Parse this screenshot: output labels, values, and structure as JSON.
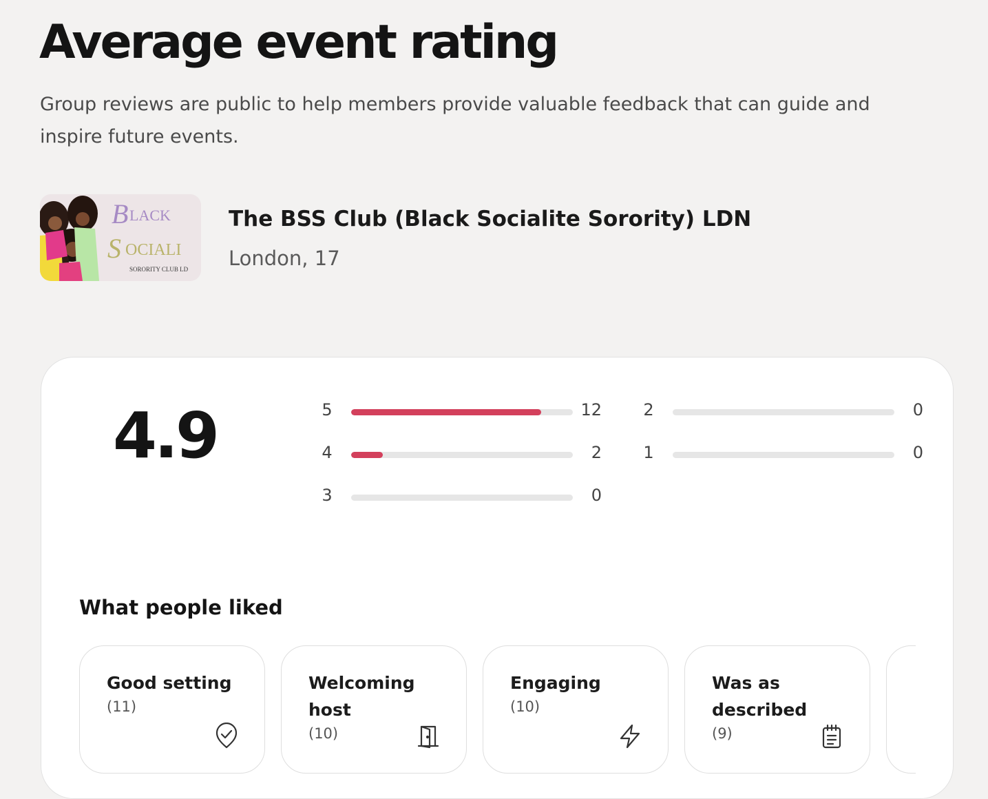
{
  "page": {
    "title": "Average event rating",
    "subtitle": "Group reviews are public to help members provide valuable feedback that can guide and inspire future events."
  },
  "group": {
    "name": "The BSS Club (Black Socialite Sorority) LDN",
    "location": "London, 17",
    "logo_text": [
      "Black",
      "Sociali",
      "SORORITY CLUB LD"
    ]
  },
  "rating": {
    "average": "4.9",
    "accent_color": "#d3405c",
    "breakdown": [
      {
        "stars": "5",
        "count": "12",
        "fraction": 0.857
      },
      {
        "stars": "4",
        "count": "2",
        "fraction": 0.143
      },
      {
        "stars": "3",
        "count": "0",
        "fraction": 0
      },
      {
        "stars": "2",
        "count": "0",
        "fraction": 0
      },
      {
        "stars": "1",
        "count": "0",
        "fraction": 0
      }
    ]
  },
  "liked": {
    "title": "What people liked",
    "items": [
      {
        "label": "Good setting",
        "count": "(11)",
        "icon": "shield-check-icon"
      },
      {
        "label": "Welcoming host",
        "count": "(10)",
        "icon": "door-icon"
      },
      {
        "label": "Engaging",
        "count": "(10)",
        "icon": "lightning-icon"
      },
      {
        "label": "Was as described",
        "count": "(9)",
        "icon": "clipboard-icon"
      }
    ]
  }
}
